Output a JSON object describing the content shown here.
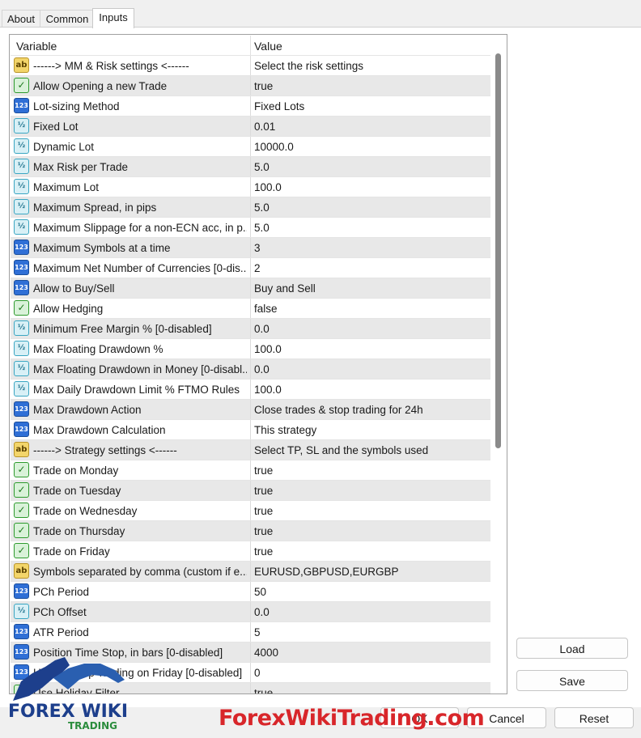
{
  "tabs": [
    {
      "label": "About"
    },
    {
      "label": "Common"
    },
    {
      "label": "Inputs"
    }
  ],
  "grid": {
    "header_variable": "Variable",
    "header_value": "Value",
    "rows": [
      {
        "icon": "string-ab-icon",
        "name": "------> MM & Risk settings <------",
        "value": "Select the risk settings"
      },
      {
        "icon": "bool-icon",
        "name": "Allow Opening a new Trade",
        "value": "true"
      },
      {
        "icon": "int-123-icon",
        "name": "Lot-sizing Method",
        "value": "Fixed Lots"
      },
      {
        "icon": "double-half-icon",
        "name": "Fixed Lot",
        "value": "0.01"
      },
      {
        "icon": "double-half-icon",
        "name": "Dynamic Lot",
        "value": "10000.0"
      },
      {
        "icon": "double-half-icon",
        "name": "Max Risk per Trade",
        "value": "5.0"
      },
      {
        "icon": "double-half-icon",
        "name": "Maximum Lot",
        "value": "100.0"
      },
      {
        "icon": "double-half-icon",
        "name": "Maximum Spread, in pips",
        "value": "5.0"
      },
      {
        "icon": "double-half-icon",
        "name": "Maximum Slippage for a non-ECN acc, in p...",
        "value": "5.0"
      },
      {
        "icon": "int-123-icon",
        "name": "Maximum Symbols at a time",
        "value": "3"
      },
      {
        "icon": "int-123-icon",
        "name": "Maximum Net Number of Currencies [0-dis...",
        "value": "2"
      },
      {
        "icon": "int-123-icon",
        "name": "Allow to Buy/Sell",
        "value": "Buy and Sell"
      },
      {
        "icon": "bool-icon",
        "name": "Allow Hedging",
        "value": "false"
      },
      {
        "icon": "double-half-icon",
        "name": "Minimum Free Margin % [0-disabled]",
        "value": "0.0"
      },
      {
        "icon": "double-half-icon",
        "name": "Max Floating Drawdown %",
        "value": "100.0"
      },
      {
        "icon": "double-half-icon",
        "name": "Max Floating Drawdown in Money [0-disabl...",
        "value": "0.0"
      },
      {
        "icon": "double-half-icon",
        "name": "Max Daily Drawdown Limit % FTMO Rules",
        "value": "100.0"
      },
      {
        "icon": "int-123-icon",
        "name": "Max Drawdown Action",
        "value": "Close trades & stop trading for 24h"
      },
      {
        "icon": "int-123-icon",
        "name": "Max Drawdown Calculation",
        "value": "This strategy"
      },
      {
        "icon": "string-ab-icon",
        "name": "------> Strategy settings <------",
        "value": "Select TP, SL and the symbols used"
      },
      {
        "icon": "bool-icon",
        "name": "Trade on Monday",
        "value": "true"
      },
      {
        "icon": "bool-icon",
        "name": "Trade on Tuesday",
        "value": "true"
      },
      {
        "icon": "bool-icon",
        "name": "Trade on Wednesday",
        "value": "true"
      },
      {
        "icon": "bool-icon",
        "name": "Trade on Thursday",
        "value": "true"
      },
      {
        "icon": "bool-icon",
        "name": "Trade on Friday",
        "value": "true"
      },
      {
        "icon": "string-ab-icon",
        "name": "Symbols separated by comma (custom if e...",
        "value": "EURUSD,GBPUSD,EURGBP"
      },
      {
        "icon": "int-123-icon",
        "name": "PCh Period",
        "value": "50"
      },
      {
        "icon": "double-half-icon",
        "name": "PCh Offset",
        "value": "0.0"
      },
      {
        "icon": "int-123-icon",
        "name": "ATR Period",
        "value": "5"
      },
      {
        "icon": "int-123-icon",
        "name": "Position Time Stop, in bars [0-disabled]",
        "value": "4000"
      },
      {
        "icon": "int-123-icon",
        "name": "Hour to Stop Trading on Friday [0-disabled]",
        "value": "0"
      },
      {
        "icon": "bool-icon",
        "name": "Use Holiday Filter",
        "value": "true"
      }
    ]
  },
  "buttons": {
    "load": "Load",
    "save": "Save",
    "ok": "OK",
    "cancel": "Cancel",
    "reset": "Reset"
  },
  "watermark": {
    "site": "ForexWikiTrading.com",
    "logo_top": "FOREX WIKI",
    "logo_bottom": "TRADING"
  },
  "colors": {
    "row_alt": "#e8e8e8",
    "watermark_red": "#d8262a",
    "logo_blue": "#1d3f8c"
  }
}
